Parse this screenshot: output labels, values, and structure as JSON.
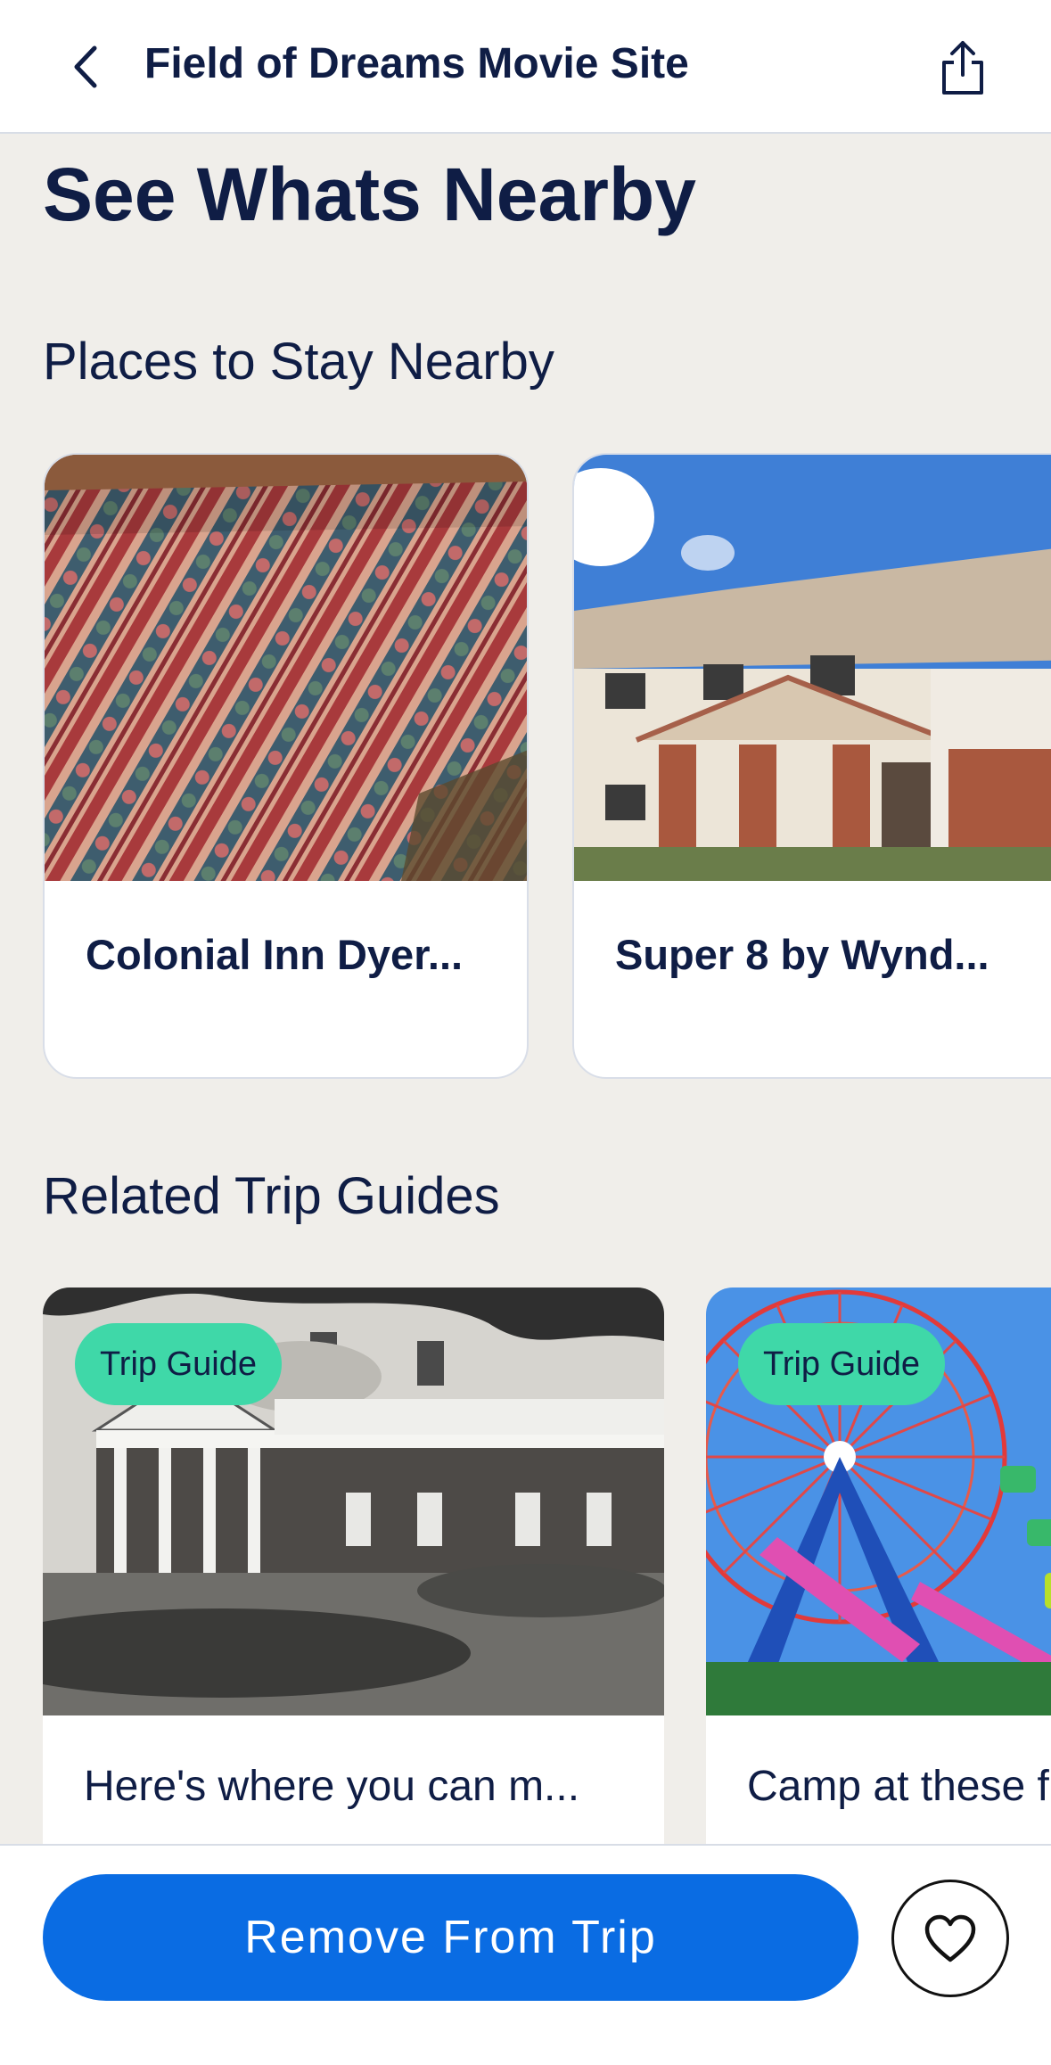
{
  "header": {
    "title": "Field of Dreams Movie Site",
    "back_icon": "chevron-left-icon",
    "share_icon": "share-icon"
  },
  "page": {
    "title": "See Whats Nearby"
  },
  "stay": {
    "section_title": "Places to Stay Nearby",
    "items": [
      {
        "label": "Colonial Inn Dyer..."
      },
      {
        "label": "Super 8 by Wynd..."
      }
    ]
  },
  "guides": {
    "section_title": "Related Trip Guides",
    "items": [
      {
        "badge": "Trip Guide",
        "label": "Here's where you can m..."
      },
      {
        "badge": "Trip Guide",
        "label": "Camp at these f"
      }
    ]
  },
  "actions": {
    "remove_label": "Remove From Trip",
    "favorite_icon": "heart-icon"
  },
  "colors": {
    "primary": "#0a6ce3",
    "badge": "#3fd8a8",
    "text": "#0f1d45",
    "background": "#f0eeea"
  }
}
